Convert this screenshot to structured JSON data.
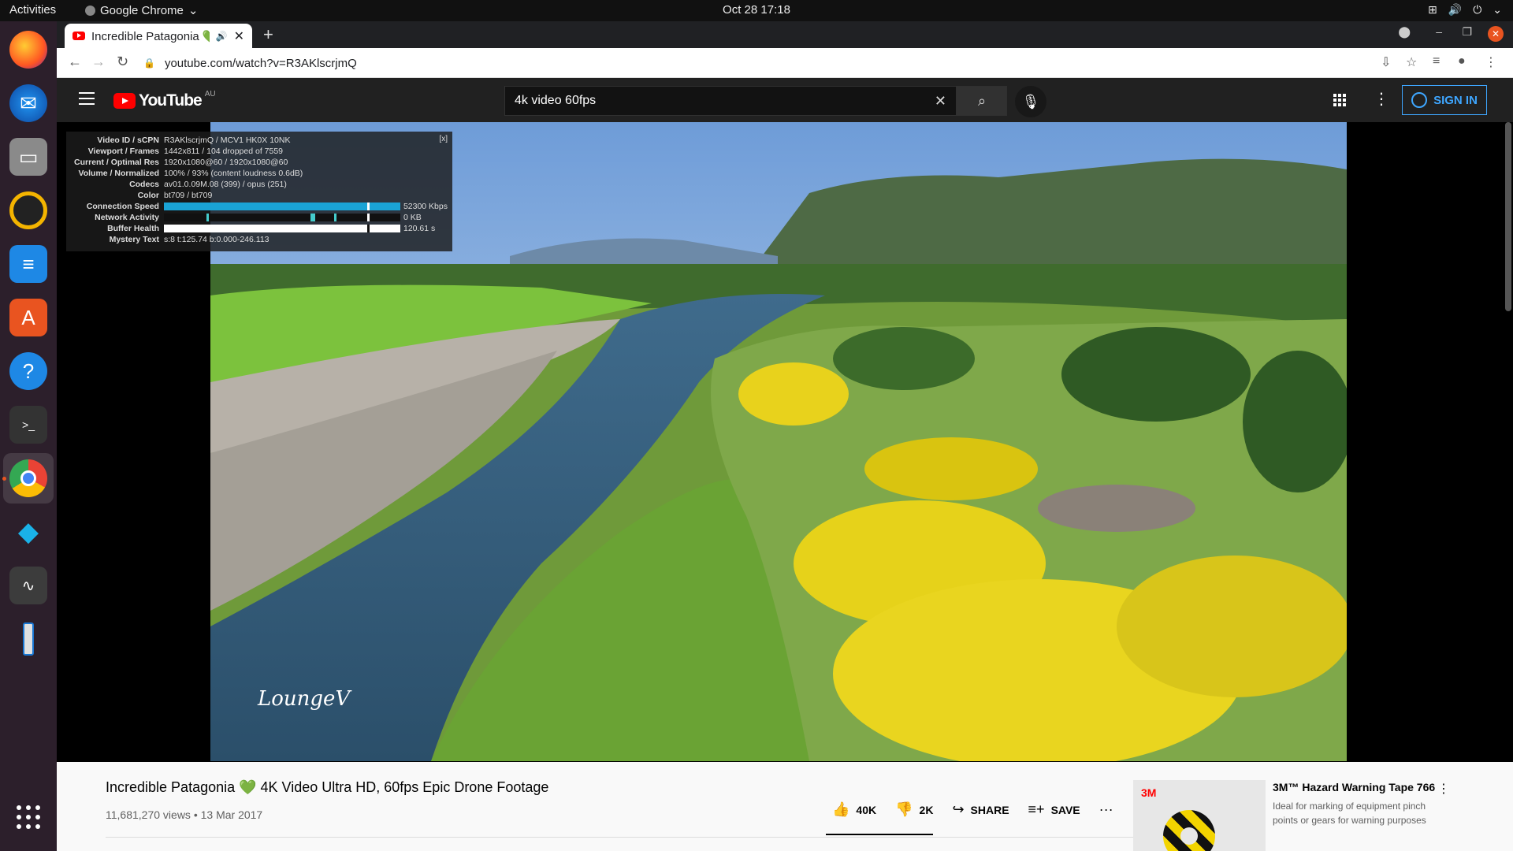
{
  "topbar": {
    "activities": "Activities",
    "app_name": "Google Chrome",
    "clock": "Oct 28  17:18"
  },
  "browser": {
    "tab_title": "Incredible Patagonia 💚",
    "url": "youtube.com/watch?v=R3AKlscrjmQ"
  },
  "youtube": {
    "logo_text": "YouTube",
    "region": "AU",
    "search_value": "4k video 60fps",
    "sign_in": "SIGN IN"
  },
  "stats": {
    "rows": [
      {
        "k": "Video ID / sCPN",
        "v": "R3AKlscrjmQ / MCV1 HK0X 10NK"
      },
      {
        "k": "Viewport / Frames",
        "v": "1442x811 / 104 dropped of 7559"
      },
      {
        "k": "Current / Optimal Res",
        "v": "1920x1080@60 / 1920x1080@60"
      },
      {
        "k": "Volume / Normalized",
        "v": "100% / 93% (content loudness 0.6dB)"
      },
      {
        "k": "Codecs",
        "v": "av01.0.09M.08 (399) / opus (251)"
      },
      {
        "k": "Color",
        "v": "bt709 / bt709"
      },
      {
        "k": "Connection Speed",
        "v": "52300 Kbps"
      },
      {
        "k": "Network Activity",
        "v": "0 KB"
      },
      {
        "k": "Buffer Health",
        "v": "120.61 s"
      },
      {
        "k": "Mystery Text",
        "v": "s:8 t:125.74 b:0.000-246.113"
      }
    ],
    "close": "[x]"
  },
  "video": {
    "watermark": "LoungeV",
    "title": "Incredible Patagonia 💚 4K Video Ultra HD, 60fps Epic Drone Footage",
    "meta": "11,681,270 views • 13 Mar 2017",
    "likes": "40K",
    "dislikes": "2K",
    "share": "SHARE",
    "save": "SAVE"
  },
  "ad": {
    "brand": "3M",
    "title": "3M™ Hazard Warning Tape 766",
    "description": "Ideal for marking of equipment pinch points or gears for warning purposes"
  }
}
